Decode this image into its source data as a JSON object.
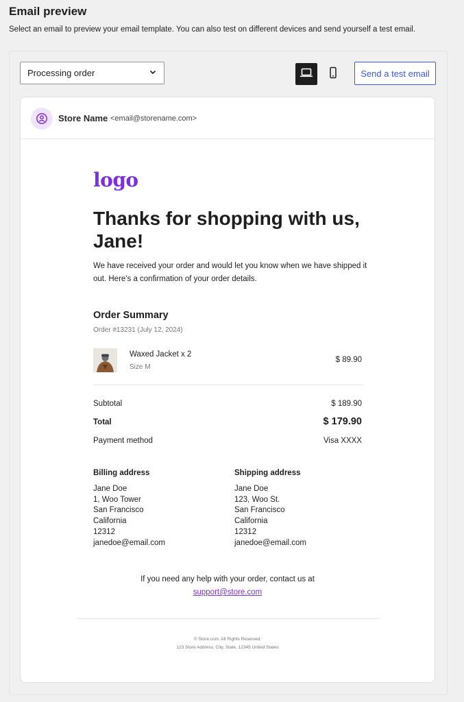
{
  "page": {
    "title": "Email preview",
    "description": "Select an email to preview your email template. You can also test on different devices and send yourself a test email."
  },
  "toolbar": {
    "template_select_value": "Processing order",
    "send_test_label": "Send a test email"
  },
  "email": {
    "store_name": "Store Name",
    "store_email": "<email@storename.com>",
    "logo_text": "logo",
    "headline": "Thanks for shopping with us, Jane!",
    "intro": "We have received your order and would let you know when we have shipped it out. Here's a confirmation of your order details.",
    "summary_title": "Order Summary",
    "order_number": "Order #13231 (July 12, 2024)",
    "item": {
      "name": "Waxed Jacket x 2",
      "variant": "Size M",
      "price": "$ 89.90"
    },
    "totals": {
      "subtotal_label": "Subtotal",
      "subtotal_value": "$ 189.90",
      "total_label": "Total",
      "total_value": "$ 179.90",
      "payment_label": "Payment method",
      "payment_value": "Visa XXXX"
    },
    "billing": {
      "title": "Billing address",
      "lines": [
        "Jane Doe",
        "1, Woo Tower",
        "San Francisco",
        "California",
        "12312",
        "janedoe@email.com"
      ]
    },
    "shipping": {
      "title": "Shipping address",
      "lines": [
        "Jane Doe",
        "123, Woo St.",
        "San Francisco",
        "California",
        "12312",
        "janedoe@email.com"
      ]
    },
    "help_text": "If you need any help with your order, contact us at",
    "help_link": "support@store.com",
    "footer_copyright": "© Store.com. All Rights Reserved.",
    "footer_address": "123 Store Address, City, State, 12345 United States"
  },
  "colors": {
    "accent": "#3858e9",
    "brand": "#7c2fe0",
    "active_device": "#1e1e1e"
  },
  "icons": {
    "select": "chevron-down-icon",
    "desktop": "desktop-icon",
    "mobile": "mobile-icon",
    "avatar": "user-circle-icon"
  }
}
